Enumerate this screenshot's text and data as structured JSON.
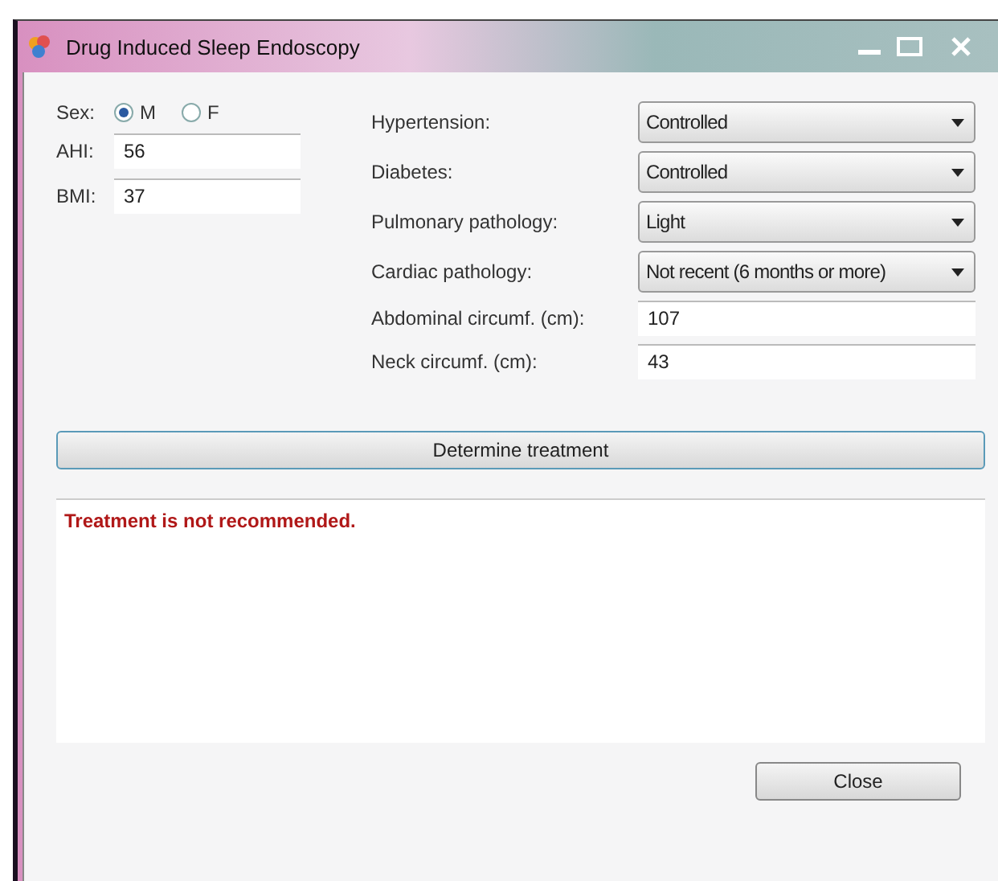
{
  "window": {
    "title": "Drug Induced Sleep Endoscopy"
  },
  "sex": {
    "label": "Sex:",
    "options": [
      {
        "label": "M",
        "selected": true
      },
      {
        "label": "F",
        "selected": false
      }
    ]
  },
  "left_fields": [
    {
      "label": "AHI:",
      "value": "56"
    },
    {
      "label": "BMI:",
      "value": "37"
    }
  ],
  "right_fields": [
    {
      "kind": "combo",
      "label": "Hypertension:",
      "value": "Controlled"
    },
    {
      "kind": "combo",
      "label": "Diabetes:",
      "value": "Controlled"
    },
    {
      "kind": "combo",
      "label": "Pulmonary pathology:",
      "value": "Light"
    },
    {
      "kind": "combo",
      "label": "Cardiac pathology:",
      "value": "Not recent (6 months or more)"
    },
    {
      "kind": "text",
      "label": "Abdominal circumf. (cm):",
      "value": "107"
    },
    {
      "kind": "text",
      "label": "Neck circumf. (cm):",
      "value": "43"
    }
  ],
  "determine_button": "Determine treatment",
  "result": "Treatment is not recommended.",
  "close_button": "Close"
}
